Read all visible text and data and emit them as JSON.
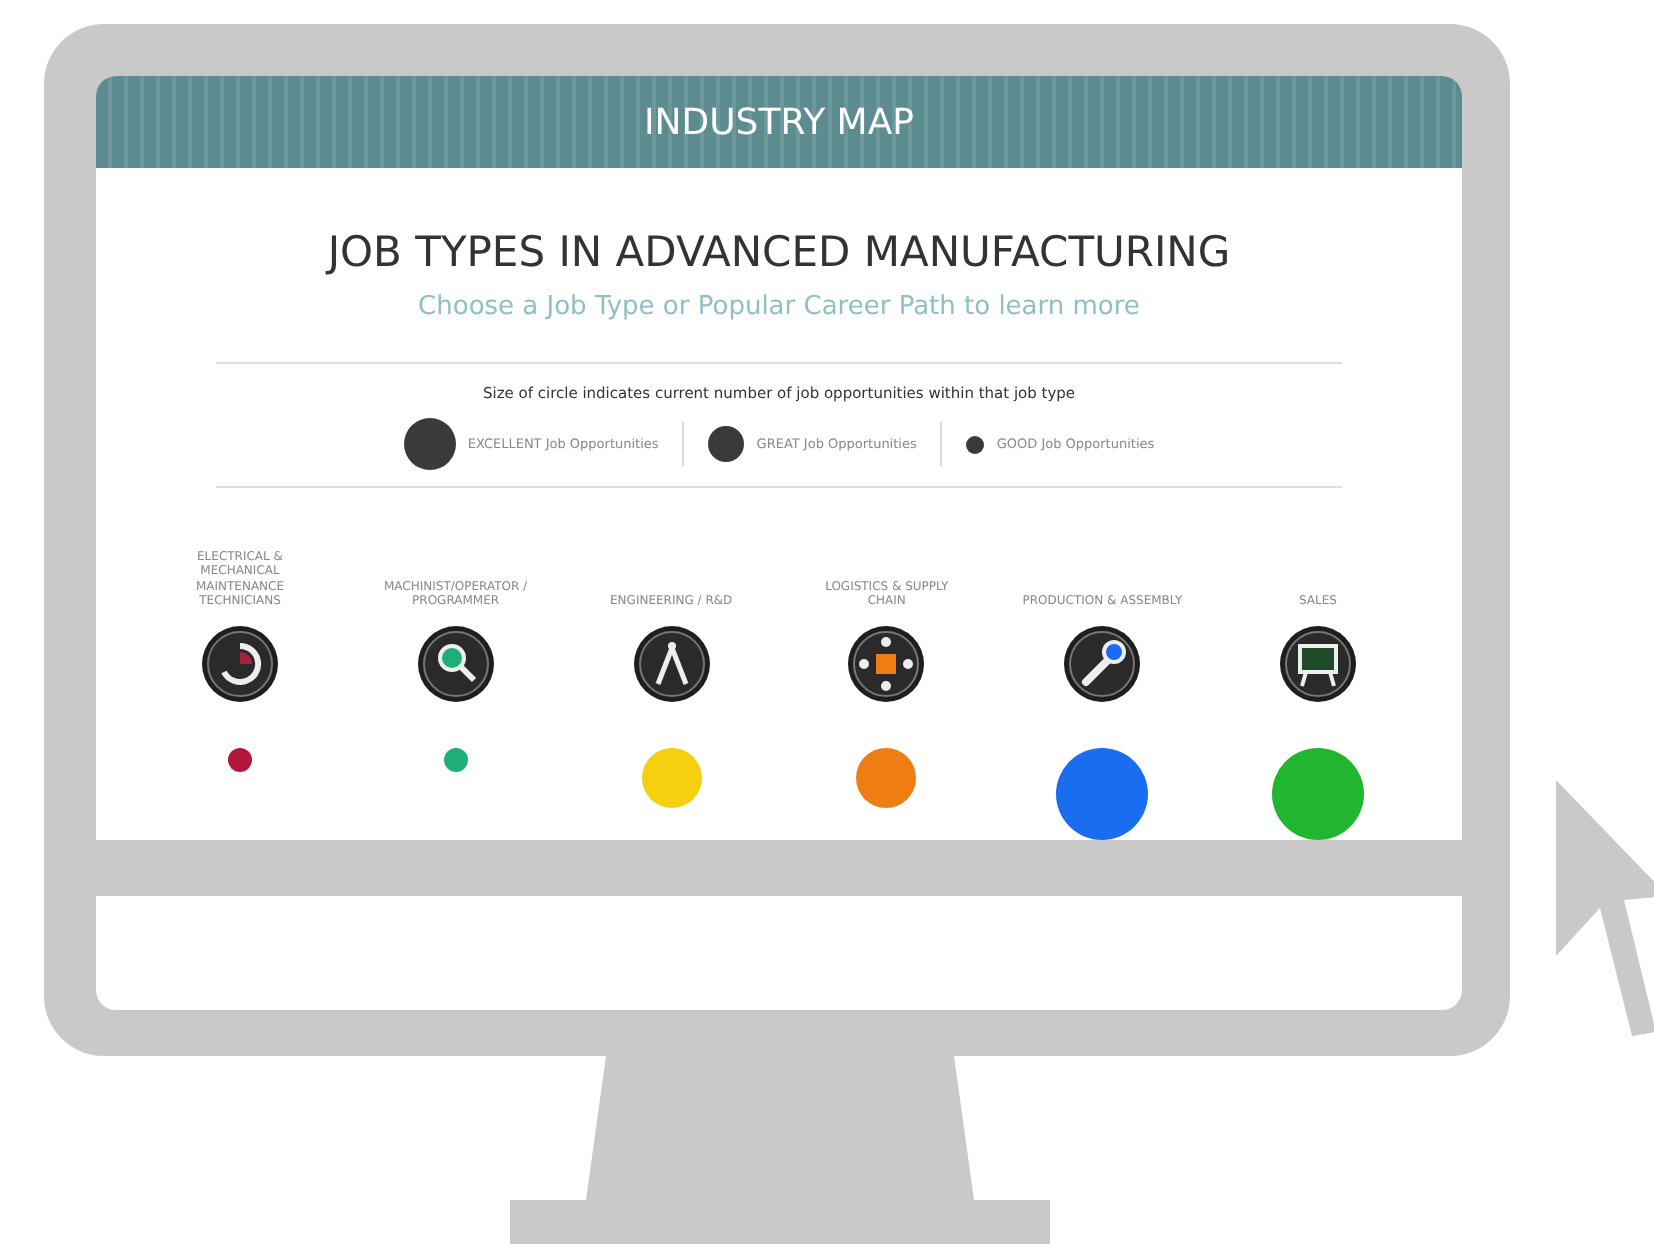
{
  "header": {
    "title": "INDUSTRY MAP"
  },
  "heading": "JOB TYPES IN ADVANCED MANUFACTURING",
  "subheading": "Choose a Job Type or Popular Career Path to learn more",
  "legend": {
    "caption": "Size of circle indicates current number of job opportunities within that job type",
    "items": [
      {
        "kind": "excellent",
        "label": "EXCELLENT Job Opportunities"
      },
      {
        "kind": "great",
        "label": "GREAT Job Opportunities"
      },
      {
        "kind": "good",
        "label": "GOOD Job Opportunities"
      }
    ]
  },
  "job_types": [
    {
      "label": "ELECTRICAL & MECHANICAL MAINTENANCE TECHNICIANS",
      "kind": "good",
      "color": "#b0173a"
    },
    {
      "label": "MACHINIST/OPERATOR / PROGRAMMER",
      "kind": "good",
      "color": "#1fae7a"
    },
    {
      "label": "ENGINEERING / R&D",
      "kind": "great",
      "color": "#f5d00f"
    },
    {
      "label": "LOGISTICS & SUPPLY CHAIN",
      "kind": "great",
      "color": "#f07d12"
    },
    {
      "label": "PRODUCTION & ASSEMBLY",
      "kind": "excellent",
      "color": "#1a6cf0"
    },
    {
      "label": "SALES",
      "kind": "excellent",
      "color": "#22b530"
    }
  ]
}
